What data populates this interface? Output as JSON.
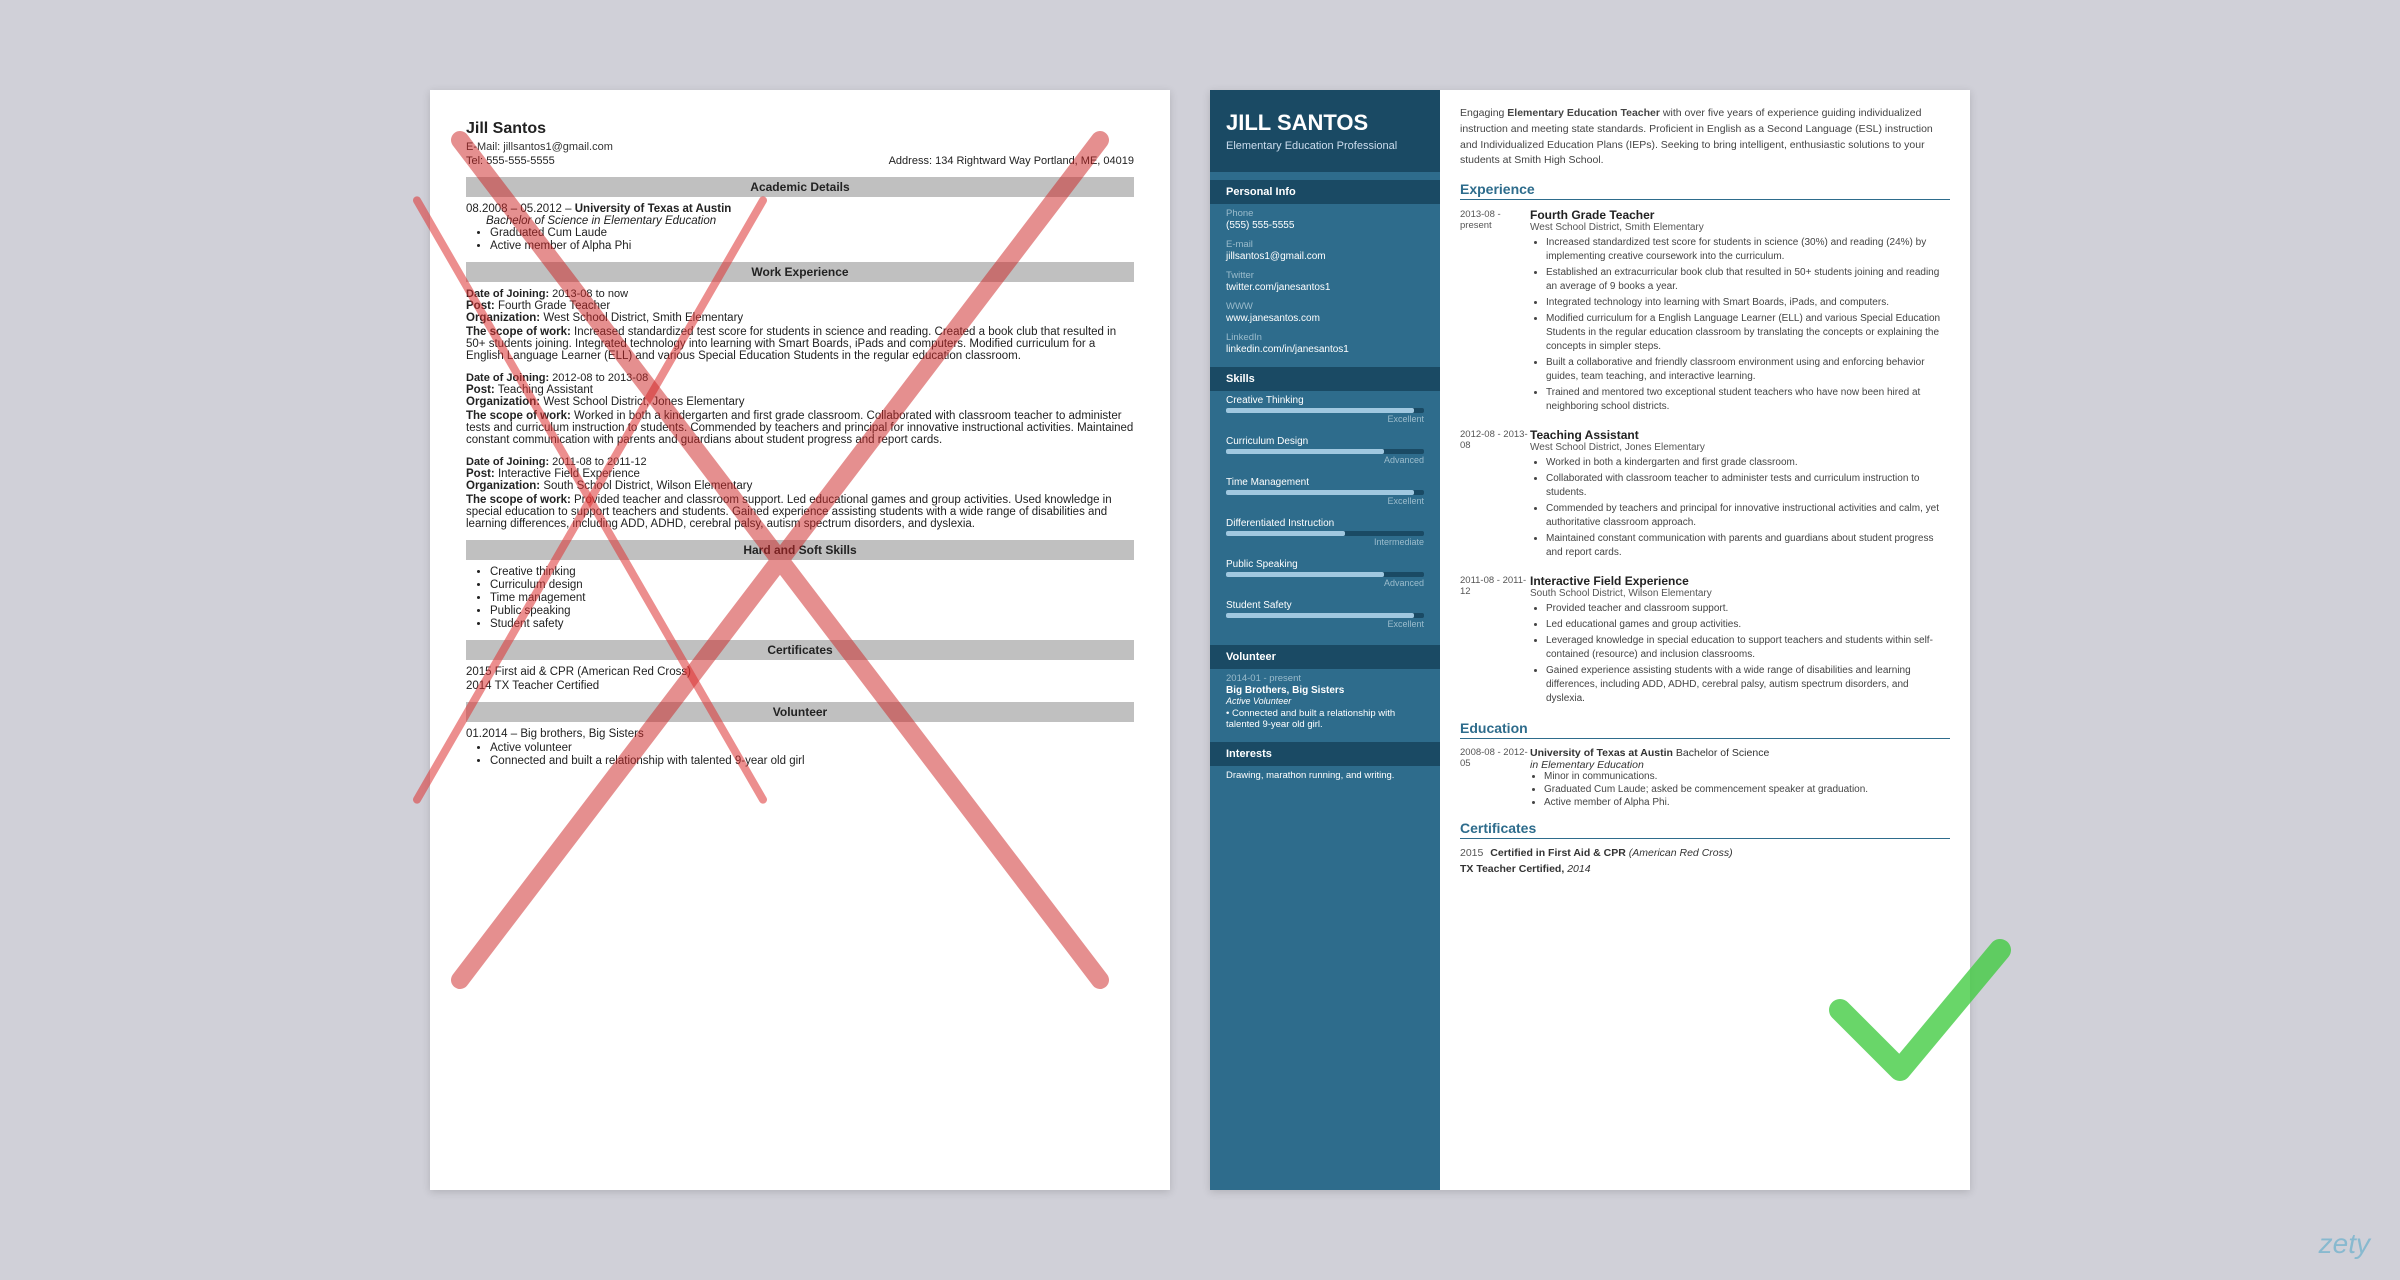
{
  "left_resume": {
    "name": "Jill Santos",
    "email_label": "E-Mail:",
    "email": "jillsantos1@gmail.com",
    "address_label": "Address:",
    "address": "134 Rightward Way Portland, ME, 04019",
    "tel_label": "Tel:",
    "tel": "555-555-5555",
    "sections": {
      "academic": "Academic Details",
      "work": "Work Experience",
      "skills": "Hard and Soft Skills",
      "certs": "Certificates",
      "volunteer": "Volunteer"
    },
    "education": {
      "dates": "08.2008 – 05.2012 –",
      "university": "University of Texas at Austin",
      "degree": "Bachelor of Science in Elementary Education",
      "bullets": [
        "Graduated Cum Laude",
        "Active member of Alpha Phi"
      ]
    },
    "work": [
      {
        "date_label": "Date of Joining:",
        "dates": "2013-08 to now",
        "post_label": "Post:",
        "post": "Fourth Grade Teacher",
        "org_label": "Organization:",
        "org": "West School District, Smith Elementary",
        "scope_label": "The scope of work:",
        "scope": "Increased standardized test score for students in science and reading. Created a book club that resulted in 50+ students joining. Integrated technology into learning with Smart Boards, iPads and computers. Modified curriculum for a English Language Learner (ELL) and various Special Education Students in the regular education classroom."
      },
      {
        "date_label": "Date of Joining:",
        "dates": "2012-08 to 2013-08",
        "post_label": "Post:",
        "post": "Teaching Assistant",
        "org_label": "Organization:",
        "org": "West School District, Jones Elementary",
        "scope_label": "The scope of work:",
        "scope": "Worked in both a kindergarten and first grade classroom. Collaborated with classroom teacher to administer tests and curriculum instruction to students. Commended by teachers and principal for innovative instructional activities. Maintained constant communication with parents and guardians about student progress and report cards."
      },
      {
        "date_label": "Date of Joining:",
        "dates": "2011-08 to 2011-12",
        "post_label": "Post:",
        "post": "Interactive Field Experience",
        "org_label": "Organization:",
        "org": "South School District, Wilson Elementary",
        "scope_label": "The scope of work:",
        "scope": "Provided teacher and classroom support. Led educational games and group activities. Used knowledge in special education to support teachers and students. Gained experience assisting students with a wide range of disabilities and learning differences, including ADD, ADHD, cerebral palsy, autism spectrum disorders, and dyslexia."
      }
    ],
    "skills_list": [
      "Creative thinking",
      "Curriculum design",
      "Time management",
      "Public speaking",
      "Student safety"
    ],
    "certs": [
      "2015 First aid & CPR (American Red Cross)",
      "2014 TX Teacher Certified"
    ],
    "volunteer": {
      "dates": "01.2014 – Big brothers, Big Sisters",
      "bullets": [
        "Active volunteer",
        "Connected and built a relationship with talented 9-year old girl"
      ]
    }
  },
  "right_resume": {
    "name": "JILL SANTOS",
    "title": "Elementary Education Professional",
    "summary": "Engaging Elementary Education Teacher with over five years of experience guiding individualized instruction and meeting state standards. Proficient in English as a Second Language (ESL) instruction and Individualized Education Plans (IEPs). Seeking to bring intelligent, enthusiastic solutions to your students at Smith High School.",
    "sidebar": {
      "personal_info_label": "Personal Info",
      "phone_label": "Phone",
      "phone": "(555) 555-5555",
      "email_label": "E-mail",
      "email": "jillsantos1@gmail.com",
      "twitter_label": "Twitter",
      "twitter": "twitter.com/janesantos1",
      "www_label": "WWW",
      "www": "www.janesantos.com",
      "linkedin_label": "LinkedIn",
      "linkedin": "linkedin.com/in/janesantos1",
      "skills_label": "Skills",
      "skills": [
        {
          "name": "Creative Thinking",
          "level": "Excellent",
          "pct": 95
        },
        {
          "name": "Curriculum Design",
          "level": "Advanced",
          "pct": 80
        },
        {
          "name": "Time Management",
          "level": "Excellent",
          "pct": 95
        },
        {
          "name": "Differentiated Instruction",
          "level": "Intermediate",
          "pct": 60
        },
        {
          "name": "Public Speaking",
          "level": "Advanced",
          "pct": 80
        },
        {
          "name": "Student Safety",
          "level": "Excellent",
          "pct": 95
        }
      ],
      "volunteer_label": "Volunteer",
      "volunteer_dates": "2014-01 - present",
      "volunteer_org": "Big Brothers, Big Sisters",
      "volunteer_role": "Active Volunteer",
      "volunteer_bullets": [
        "Connected and built a relationship with talented 9-year old girl."
      ],
      "interests_label": "Interests",
      "interests": "Drawing, marathon running, and writing."
    },
    "experience_label": "Experience",
    "experience": [
      {
        "dates": "2013-08 - present",
        "title": "Fourth Grade Teacher",
        "org": "West School District, Smith Elementary",
        "bullets": [
          "Increased standardized test score for students in science (30%) and reading (24%) by implementing creative coursework into the curriculum.",
          "Established an extracurricular book club that resulted in 50+ students joining and reading an average of 9 books a year.",
          "Integrated technology into learning with Smart Boards, iPads, and computers.",
          "Modified curriculum for a English Language Learner (ELL) and various Special Education Students in the regular education classroom by translating the concepts or explaining the concepts in simpler steps.",
          "Built a collaborative and friendly classroom environment using and enforcing behavior guides, team teaching, and interactive learning.",
          "Trained and mentored two exceptional student teachers who have now been hired at neighboring school districts."
        ]
      },
      {
        "dates": "2012-08 - 2013-08",
        "title": "Teaching Assistant",
        "org": "West School District, Jones Elementary",
        "bullets": [
          "Worked in both a kindergarten and first grade classroom.",
          "Collaborated with classroom teacher to administer tests and curriculum instruction to students.",
          "Commended by teachers and principal for innovative instructional activities and calm, yet authoritative classroom approach.",
          "Maintained constant communication with parents and guardians about student progress and report cards."
        ]
      },
      {
        "dates": "2011-08 - 2011-12",
        "title": "Interactive Field Experience",
        "org": "South School District, Wilson Elementary",
        "bullets": [
          "Provided teacher and classroom support.",
          "Led educational games and group activities.",
          "Leveraged knowledge in special education to support teachers and students within self-contained (resource) and inclusion classrooms.",
          "Gained experience assisting students with a wide range of disabilities and learning differences, including ADD, ADHD, cerebral palsy, autism spectrum disorders, and dyslexia."
        ]
      }
    ],
    "education_label": "Education",
    "education": [
      {
        "dates": "2008-08 - 2012-05",
        "university": "University of Texas at Austin",
        "degree": "Bachelor of Science",
        "field": "in Elementary Education",
        "bullets": [
          "Minor in communications.",
          "Graduated Cum Laude; asked be commencement speaker at graduation.",
          "Active member of Alpha Phi."
        ]
      }
    ],
    "certificates_label": "Certificates",
    "certificates": [
      {
        "year": "2015",
        "text": "Certified in First Aid & CPR",
        "italic": "(American Red Cross)"
      },
      {
        "year": "",
        "text": "TX Teacher Certified,",
        "italic": "2014"
      }
    ]
  },
  "watermark": "zety"
}
